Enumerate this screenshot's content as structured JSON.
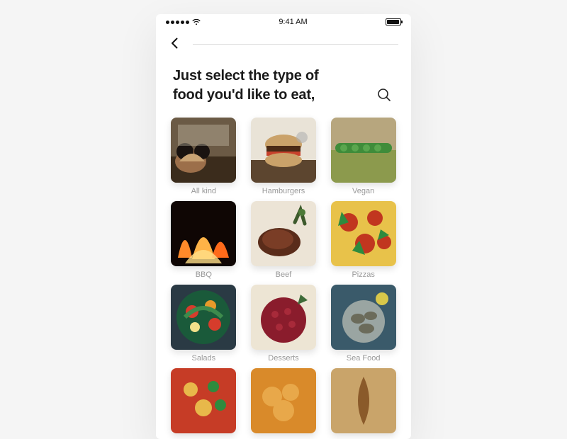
{
  "status_bar": {
    "time": "9:41 AM"
  },
  "heading": "Just select the type of food you'd like to eat,",
  "categories": [
    {
      "label": "All kind"
    },
    {
      "label": "Hamburgers"
    },
    {
      "label": "Vegan"
    },
    {
      "label": "BBQ"
    },
    {
      "label": "Beef"
    },
    {
      "label": "Pizzas"
    },
    {
      "label": "Salads"
    },
    {
      "label": "Desserts"
    },
    {
      "label": "Sea Food"
    },
    {
      "label": ""
    },
    {
      "label": ""
    },
    {
      "label": ""
    }
  ]
}
